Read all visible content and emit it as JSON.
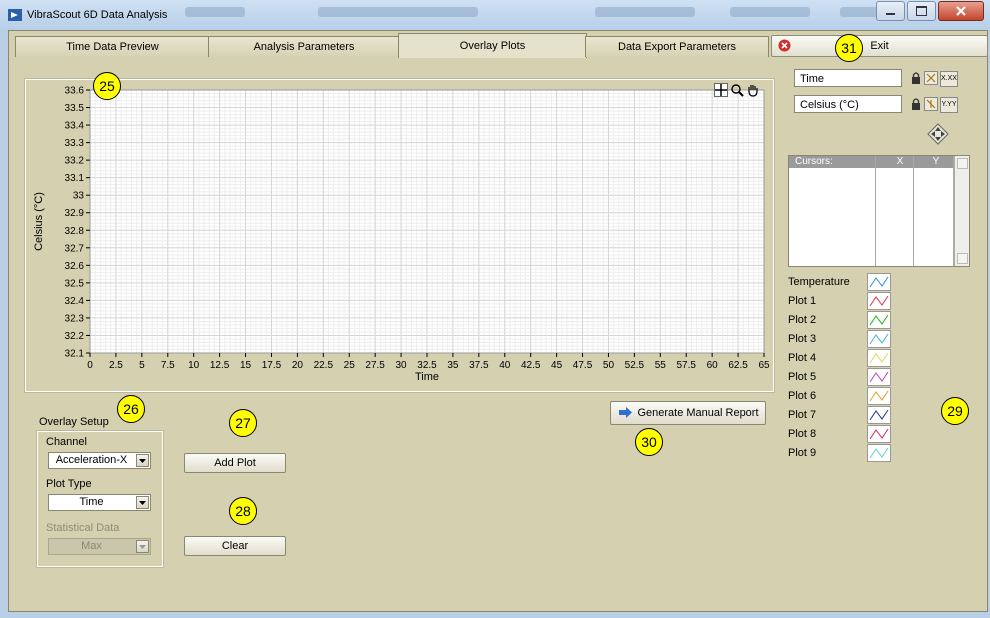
{
  "window": {
    "title": "VibraScout 6D Data Analysis"
  },
  "tabs": [
    {
      "label": "Time Data Preview"
    },
    {
      "label": "Analysis Parameters"
    },
    {
      "label": "Overlay Plots"
    },
    {
      "label": "Data Export Parameters"
    }
  ],
  "exit_label": "Exit",
  "graph": {
    "x_axis_label": "Time",
    "y_axis_label": "Celsius (°C)",
    "x_ticks": [
      "0",
      "2.5",
      "5",
      "7.5",
      "10",
      "12.5",
      "15",
      "17.5",
      "20",
      "22.5",
      "25",
      "27.5",
      "30",
      "32.5",
      "35",
      "37.5",
      "40",
      "42.5",
      "45",
      "47.5",
      "50",
      "52.5",
      "55",
      "57.5",
      "60",
      "62.5",
      "65"
    ],
    "y_ticks": [
      "33.6",
      "33.5",
      "33.4",
      "33.3",
      "33.2",
      "33.1",
      "33",
      "32.9",
      "32.8",
      "32.7",
      "32.6",
      "32.5",
      "32.4",
      "32.3",
      "32.2",
      "32.1"
    ],
    "x_range": [
      0,
      65
    ],
    "y_range": [
      32.1,
      33.6
    ],
    "grid": true
  },
  "axis_controls": {
    "x_name": "Time",
    "y_name": "Celsius (°C)",
    "x_format_label": "X.XX",
    "y_format_label": "Y.YY"
  },
  "cursor_table": {
    "headers": [
      "Cursors:",
      "X",
      "Y"
    ]
  },
  "plot_legend": [
    {
      "label": "Temperature",
      "color": "#2a8cd8"
    },
    {
      "label": "Plot 1",
      "color": "#e03050"
    },
    {
      "label": "Plot 2",
      "color": "#20b020"
    },
    {
      "label": "Plot 3",
      "color": "#40b0e0"
    },
    {
      "label": "Plot 4",
      "color": "#d8d860"
    },
    {
      "label": "Plot 5",
      "color": "#c040c0"
    },
    {
      "label": "Plot 6",
      "color": "#e0a020"
    },
    {
      "label": "Plot 7",
      "color": "#203080"
    },
    {
      "label": "Plot 8",
      "color": "#e02060"
    },
    {
      "label": "Plot 9",
      "color": "#60d0d0"
    }
  ],
  "overlay_setup": {
    "title": "Overlay Setup",
    "channel_label": "Channel",
    "channel_value": "Acceleration-X",
    "plot_type_label": "Plot Type",
    "plot_type_value": "Time",
    "stat_label": "Statistical Data",
    "stat_value": "Max"
  },
  "buttons": {
    "add_plot": "Add Plot",
    "clear": "Clear",
    "generate_report": "Generate Manual Report"
  },
  "badges": {
    "b25": "25",
    "b26": "26",
    "b27": "27",
    "b28": "28",
    "b29": "29",
    "b30": "30",
    "b31": "31"
  },
  "colors": {
    "panel_bg": "#d4d0b0",
    "badge": "#ffff00"
  }
}
